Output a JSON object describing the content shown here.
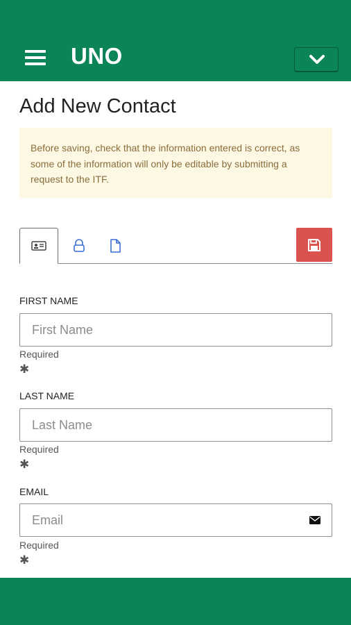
{
  "app": {
    "title": "UNO"
  },
  "header": {
    "menu_icon": "hamburger-icon",
    "dropdown_icon": "chevron-down-icon"
  },
  "page": {
    "title": "Add New Contact"
  },
  "alert": {
    "text": "Before saving, check that the information entered is correct, as some of the information will only be editable by submitting a request to the ITF.",
    "color": "#8a6d3b",
    "background": "#fcf8e3"
  },
  "tabs": [
    {
      "icon": "id-card-icon",
      "active": true
    },
    {
      "icon": "lock-icon",
      "active": false
    },
    {
      "icon": "document-icon",
      "active": false
    }
  ],
  "save_button": {
    "icon": "floppy-disk-icon",
    "color": "#d9534f"
  },
  "form": {
    "first_name": {
      "label": "FIRST NAME",
      "placeholder": "First Name",
      "value": "",
      "help": "Required",
      "required_mark": "✱"
    },
    "last_name": {
      "label": "LAST NAME",
      "placeholder": "Last Name",
      "value": "",
      "help": "Required",
      "required_mark": "✱"
    },
    "email": {
      "label": "EMAIL",
      "placeholder": "Email",
      "value": "",
      "help": "Required",
      "required_mark": "✱",
      "icon": "envelope-icon"
    }
  },
  "colors": {
    "brand": "#0b8457",
    "danger": "#d9534f"
  }
}
